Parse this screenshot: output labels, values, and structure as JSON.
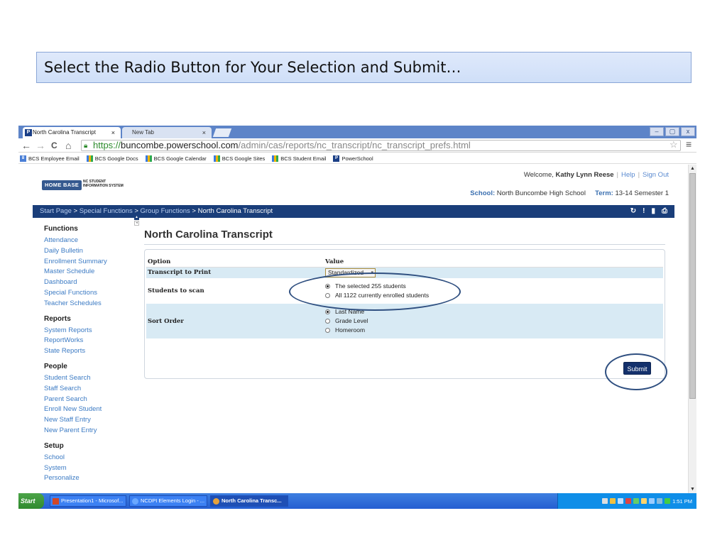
{
  "slide": {
    "title": "Select the Radio Button for Your Selection and Submit…"
  },
  "browser": {
    "tabs": [
      {
        "label": "North Carolina Transcript",
        "favicon": "P",
        "close": "×"
      },
      {
        "label": "New Tab",
        "close": "×"
      }
    ],
    "window_controls": [
      "–",
      "▢",
      "x"
    ],
    "nav": {
      "back": "←",
      "forward": "→",
      "reload": "C",
      "home": "⌂"
    },
    "url": {
      "scheme": "https://",
      "host": "buncombe.powerschool.com",
      "path": "/admin/cas/reports/nc_transcript/nc_transcript_prefs.html"
    },
    "bookmarks": [
      {
        "label": "BCS Employee Email",
        "icon": "g"
      },
      {
        "label": "BCS Google Docs",
        "icon": "multi"
      },
      {
        "label": "BCS Google Calendar",
        "icon": "multi"
      },
      {
        "label": "BCS Google Sites",
        "icon": "multi"
      },
      {
        "label": "BCS Student Email",
        "icon": "multi"
      },
      {
        "label": "PowerSchool",
        "icon": "ps"
      }
    ]
  },
  "header": {
    "logo": "HOME BASE",
    "logo_sub_1": "NC STUDENT",
    "logo_sub_2": "INFORMATION SYSTEM",
    "welcome_prefix": "Welcome,",
    "user_name": "Kathy Lynn Reese",
    "help": "Help",
    "sign_out": "Sign Out",
    "school_label": "School:",
    "school_name": "North Buncombe High School",
    "term_label": "Term:",
    "term_value": "13-14 Semester 1"
  },
  "breadcrumb": {
    "items": [
      "Start Page",
      "Special Functions",
      "Group Functions"
    ],
    "current": "North Carolina Transcript",
    "separator": " > "
  },
  "sidebar": {
    "groups": [
      {
        "heading": "Functions",
        "items": [
          "Attendance",
          "Daily Bulletin",
          "Enrollment Summary",
          "Master Schedule",
          "Dashboard",
          "Special Functions",
          "Teacher Schedules"
        ]
      },
      {
        "heading": "Reports",
        "items": [
          "System Reports",
          "ReportWorks",
          "State Reports"
        ]
      },
      {
        "heading": "People",
        "items": [
          "Student Search",
          "Staff Search",
          "Parent Search",
          "Enroll New Student",
          "New Staff Entry",
          "New Parent Entry"
        ]
      },
      {
        "heading": "Setup",
        "items": [
          "School",
          "System",
          "Personalize"
        ]
      }
    ]
  },
  "main": {
    "title": "North Carolina Transcript",
    "table": {
      "col_option": "Option",
      "col_value": "Value",
      "transcript_label": "Transcript to Print",
      "transcript_value": "Standardized",
      "students_label": "Students to scan",
      "students_options": [
        "The selected 255 students",
        "All 1122 currently enrolled students"
      ],
      "sort_label": "Sort Order",
      "sort_options": [
        "Last Name",
        "Grade Level",
        "Homeroom"
      ]
    },
    "submit": "Submit"
  },
  "taskbar": {
    "start": "Start",
    "tasks": [
      "Presentation1 - Microsof...",
      "NCDPI Elements Login - ...",
      "North Carolina Transc..."
    ],
    "clock": "1:51 PM"
  }
}
